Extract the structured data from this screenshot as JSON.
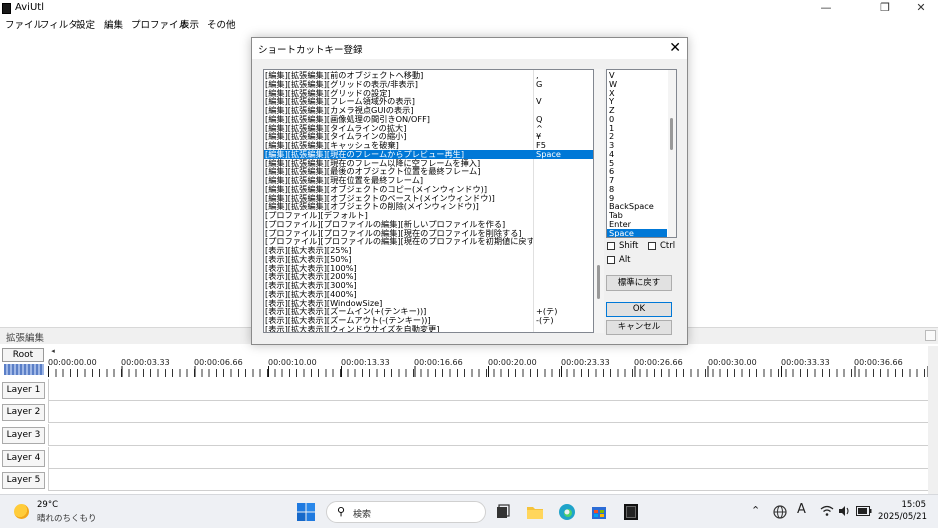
{
  "window": {
    "title": "AviUtl"
  },
  "menu": [
    "ファイル",
    "フィルタ",
    "設定",
    "編集",
    "プロファイル",
    "表示",
    "その他"
  ],
  "dialog": {
    "title": "ショートカットキー登録",
    "close_glyph": "✕",
    "commands": [
      {
        "text": "[編集][拡張編集][前のオブジェクトへ移動]",
        "key": ","
      },
      {
        "text": "[編集][拡張編集][グリッドの表示/非表示]",
        "key": "G"
      },
      {
        "text": "[編集][拡張編集][グリッドの設定]",
        "key": ""
      },
      {
        "text": "[編集][拡張編集][フレーム領域外の表示]",
        "key": "V"
      },
      {
        "text": "[編集][拡張編集][カメラ視点GUIの表示]",
        "key": ""
      },
      {
        "text": "[編集][拡張編集][画像処理の間引きON/OFF]",
        "key": "Q"
      },
      {
        "text": "[編集][拡張編集][タイムラインの拡大]",
        "key": "^"
      },
      {
        "text": "[編集][拡張編集][タイムラインの縮小]",
        "key": "¥"
      },
      {
        "text": "[編集][拡張編集][キャッシュを破棄]",
        "key": "F5"
      },
      {
        "text": "[編集][拡張編集][現在のフレームからプレビュー再生]",
        "key": "Space"
      },
      {
        "text": "[編集][拡張編集][現在のフレーム以降に空フレームを挿入]",
        "key": ""
      },
      {
        "text": "[編集][拡張編集][最後のオブジェクト位置を最終フレーム]",
        "key": ""
      },
      {
        "text": "[編集][拡張編集][現在位置を最終フレーム]",
        "key": ""
      },
      {
        "text": "[編集][拡張編集][オブジェクトのコピー(メインウィンドウ)]",
        "key": ""
      },
      {
        "text": "[編集][拡張編集][オブジェクトのペースト(メインウィンドウ)]",
        "key": ""
      },
      {
        "text": "[編集][拡張編集][オブジェクトの削除(メインウィンドウ)]",
        "key": ""
      },
      {
        "text": "[プロファイル][デフォルト]",
        "key": ""
      },
      {
        "text": "[プロファイル][プロファイルの編集][新しいプロファイルを作る]",
        "key": ""
      },
      {
        "text": "[プロファイル][プロファイルの編集][現在のプロファイルを削除する]",
        "key": ""
      },
      {
        "text": "[プロファイル][プロファイルの編集][現在のプロファイルを初期値に戻す]",
        "key": ""
      },
      {
        "text": "[表示][拡大表示][25%]",
        "key": ""
      },
      {
        "text": "[表示][拡大表示][50%]",
        "key": ""
      },
      {
        "text": "[表示][拡大表示][100%]",
        "key": ""
      },
      {
        "text": "[表示][拡大表示][200%]",
        "key": ""
      },
      {
        "text": "[表示][拡大表示][300%]",
        "key": ""
      },
      {
        "text": "[表示][拡大表示][400%]",
        "key": ""
      },
      {
        "text": "[表示][拡大表示][WindowSize]",
        "key": ""
      },
      {
        "text": "[表示][拡大表示][ズームイン(+(テンキー))]",
        "key": "+(テ)"
      },
      {
        "text": "[表示][拡大表示][ズームアウト(-(テンキー))]",
        "key": "-(テ)"
      },
      {
        "text": "[表示][拡大表示][ウィンドウサイズを自動変更]",
        "key": ""
      }
    ],
    "selected_command_index": 9,
    "keys": [
      "V",
      "W",
      "X",
      "Y",
      "Z",
      "0",
      "1",
      "2",
      "3",
      "4",
      "5",
      "6",
      "7",
      "8",
      "9",
      "BackSpace",
      "Tab",
      "Enter",
      "Space"
    ],
    "selected_key_index": 18,
    "modifiers": {
      "shift": "Shift",
      "ctrl": "Ctrl",
      "alt": "Alt"
    },
    "buttons": {
      "reset": "標準に戻す",
      "ok": "OK",
      "cancel": "キャンセル"
    }
  },
  "timeline": {
    "title": "拡張編集",
    "root_label": "Root",
    "nav_glyph": "◂",
    "ticks": [
      "00:00:00.00",
      "00:00:03.33",
      "00:00:06.66",
      "00:00:10.00",
      "00:00:13.33",
      "00:00:16.66",
      "00:00:20.00",
      "00:00:23.33",
      "00:00:26.66",
      "00:00:30.00",
      "00:00:33.33",
      "00:00:36.66"
    ],
    "layers": [
      "Layer 1",
      "Layer 2",
      "Layer 3",
      "Layer 4",
      "Layer 5"
    ]
  },
  "taskbar": {
    "temperature": "29°C",
    "weather": "晴れのちくもり",
    "search_placeholder": "検索",
    "time": "15:05",
    "date": "2025/05/21",
    "ime_indicator": "A"
  }
}
